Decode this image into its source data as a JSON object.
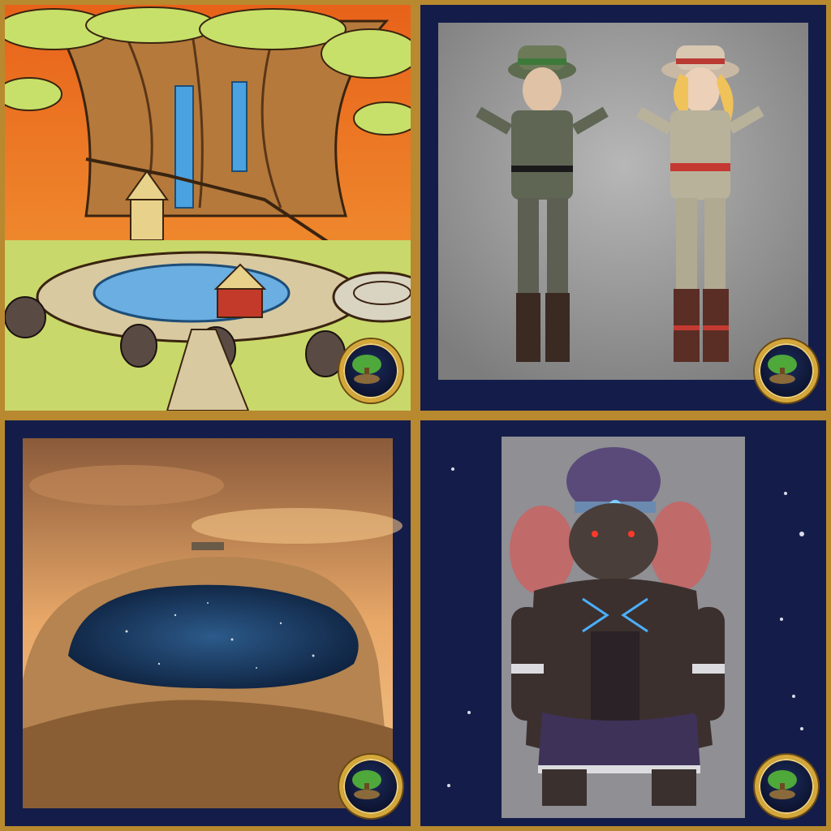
{
  "panels": [
    {
      "id": "zafaria-hub-sketch",
      "icon": "tree-hub-concept-art",
      "badge_icon": "zafaria-world-emblem-icon"
    },
    {
      "id": "explorer-outfits",
      "icon": "safari-characters-concept-art",
      "badge_icon": "zafaria-world-emblem-icon"
    },
    {
      "id": "crater-lake",
      "icon": "starry-crater-lake-concept-art",
      "badge_icon": "zafaria-world-emblem-icon"
    },
    {
      "id": "elephant-character",
      "icon": "elephant-warrior-concept-art",
      "badge_icon": "zafaria-world-emblem-icon"
    }
  ],
  "colors": {
    "frame_gold": "#b8892f",
    "frame_red": "#8a1e1e",
    "space_navy": "#141d4a"
  }
}
